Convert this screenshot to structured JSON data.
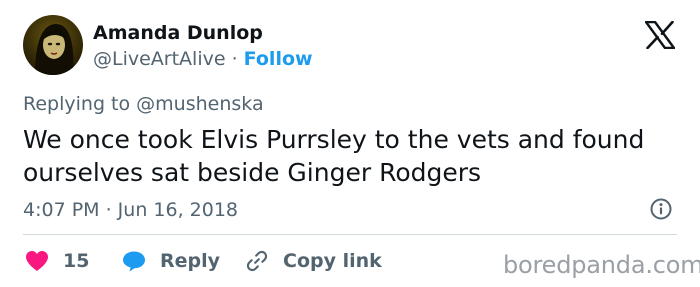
{
  "author": {
    "display_name": "Amanda Dunlop",
    "handle": "@LiveArtAlive",
    "separator": " · ",
    "follow_label": "Follow"
  },
  "tweet": {
    "replying_to_prefix": "Replying to ",
    "replying_to_handle": "@mushenska",
    "text": "We once took Elvis Purrsley to the vets and found ourselves sat beside Ginger Rodgers",
    "timestamp": "4:07 PM · Jun 16, 2018"
  },
  "actions": {
    "like_count": "15",
    "reply_label": "Reply",
    "copy_link_label": "Copy link"
  },
  "icons": {
    "brand": "x-logo-icon",
    "info": "info-icon",
    "like": "heart-icon",
    "reply": "speech-bubble-icon",
    "copy": "link-icon"
  },
  "colors": {
    "text": "#0f1419",
    "secondary": "#536471",
    "link": "#1d9bf0",
    "like": "#f91880",
    "reply": "#1d9bf0"
  },
  "watermark": "boredpanda.com"
}
